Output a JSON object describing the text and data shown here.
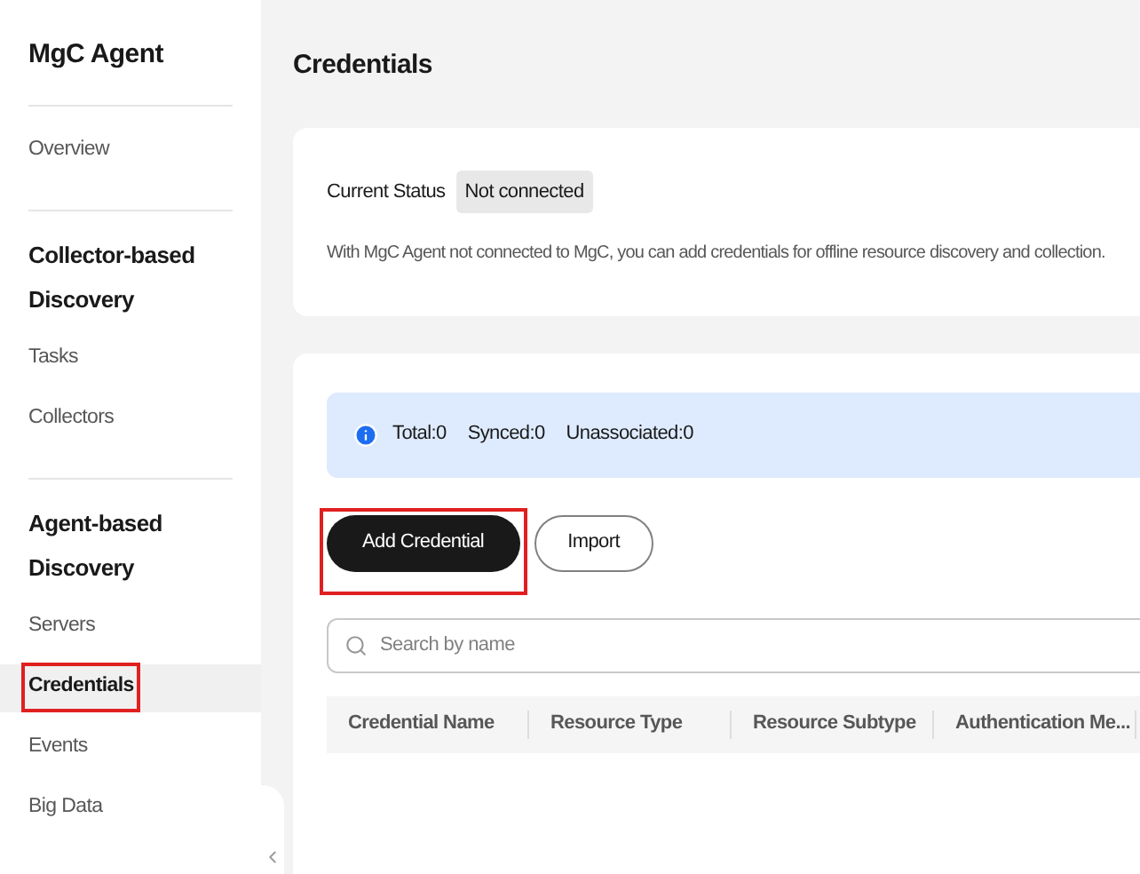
{
  "sidebar": {
    "title": "MgC Agent",
    "sections": [
      {
        "items": [
          {
            "label": "Overview",
            "selected": false,
            "highlighted": false
          }
        ]
      },
      {
        "heading": "Collector-based Discovery",
        "items": [
          {
            "label": "Tasks",
            "selected": false,
            "highlighted": false
          },
          {
            "label": "Collectors",
            "selected": false,
            "highlighted": false
          }
        ]
      },
      {
        "heading": "Agent-based Discovery",
        "items": [
          {
            "label": "Servers",
            "selected": false,
            "highlighted": false
          },
          {
            "label": "Credentials",
            "selected": true,
            "highlighted": true
          },
          {
            "label": "Events",
            "selected": false,
            "highlighted": false
          },
          {
            "label": "Big Data",
            "selected": false,
            "highlighted": false
          }
        ]
      }
    ]
  },
  "page_title": "Credentials",
  "status_card": {
    "label": "Current Status",
    "status": "Not connected",
    "description": "With MgC Agent not connected to MgC, you can add credentials for offline resource discovery and collection."
  },
  "summary": [
    "Total:0",
    "Synced:0",
    "Unassociated:0"
  ],
  "buttons": [
    {
      "label": "Add Credential",
      "kind": "primary",
      "highlighted": true
    },
    {
      "label": "Import",
      "kind": "secondary",
      "highlighted": false
    }
  ],
  "search": {
    "placeholder": "Search by name"
  },
  "table": {
    "columns": [
      "Credential Name",
      "Resource Type",
      "Resource Subtype",
      "Authentication Me..."
    ]
  }
}
